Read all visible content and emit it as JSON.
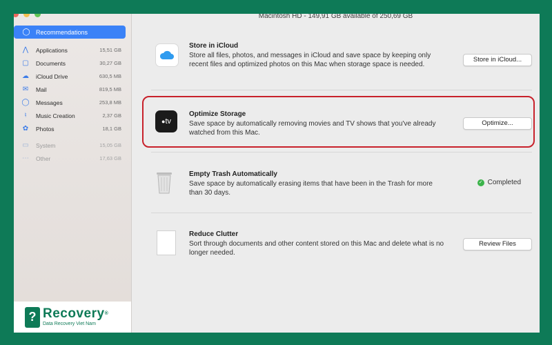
{
  "disk": {
    "title": "Macintosh HD - 149,91 GB available of 250,69 GB"
  },
  "sidebar": {
    "selected": {
      "label": "Recommendations",
      "icon": "lightbulb-icon"
    },
    "items": [
      {
        "label": "Applications",
        "size": "15,51 GB",
        "icon": "applications-icon"
      },
      {
        "label": "Documents",
        "size": "30,27 GB",
        "icon": "document-icon"
      },
      {
        "label": "iCloud Drive",
        "size": "630,5 MB",
        "icon": "cloud-icon"
      },
      {
        "label": "Mail",
        "size": "819,5 MB",
        "icon": "mail-icon"
      },
      {
        "label": "Messages",
        "size": "253,8 MB",
        "icon": "messages-icon"
      },
      {
        "label": "Music Creation",
        "size": "2,37 GB",
        "icon": "music-icon"
      },
      {
        "label": "Photos",
        "size": "18,1 GB",
        "icon": "photos-icon"
      }
    ],
    "dim_items": [
      {
        "label": "System",
        "size": "15,05 GB",
        "icon": "system-icon"
      },
      {
        "label": "Other",
        "size": "17,63 GB",
        "icon": "other-icon"
      }
    ]
  },
  "recommendations": {
    "icloud": {
      "title": "Store in iCloud",
      "description": "Store all files, photos, and messages in iCloud and save space by keeping only recent files and optimized photos on this Mac when storage space is needed.",
      "button": "Store in iCloud..."
    },
    "optimize": {
      "title": "Optimize Storage",
      "description": "Save space by automatically removing movies and TV shows that you've already watched from this Mac.",
      "button": "Optimize...",
      "icon_text": "tv"
    },
    "trash": {
      "title": "Empty Trash Automatically",
      "description": "Save space by automatically erasing items that have been in the Trash for more than 30 days.",
      "status": "Completed"
    },
    "clutter": {
      "title": "Reduce Clutter",
      "description": "Sort through documents and other content stored on this Mac and delete what is no longer needed.",
      "button": "Review Files"
    }
  },
  "logo": {
    "name": "Recovery",
    "registered": "®",
    "tagline": "Data Recovery Viet Nam"
  },
  "colors": {
    "accent": "#3b82f7",
    "frame": "#0e7a57",
    "highlight": "#c8202a",
    "success": "#3bb34a"
  }
}
